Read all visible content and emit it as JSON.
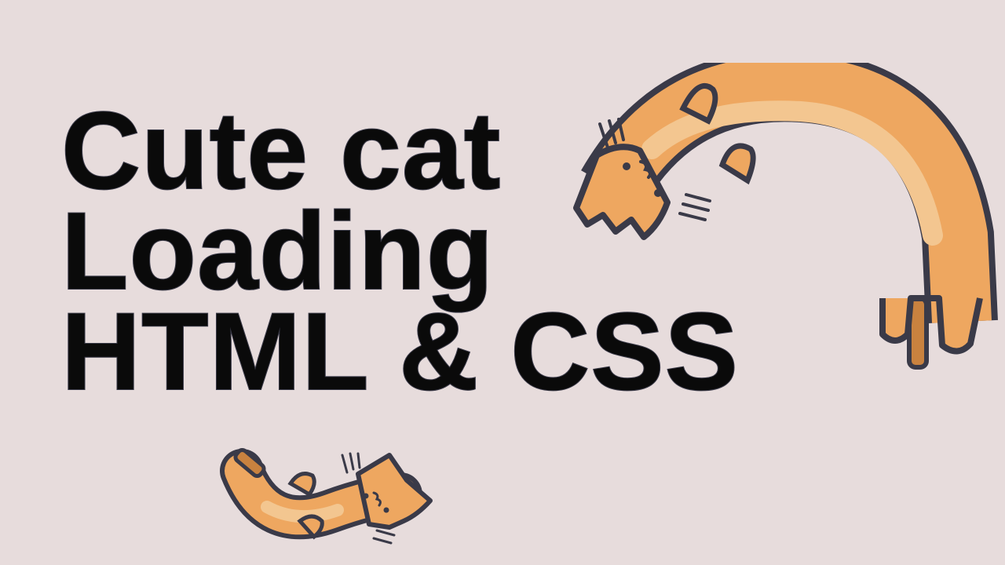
{
  "page": {
    "background": "#e7dcdc"
  },
  "title": {
    "lines": [
      "Cute cat",
      "Loading",
      "HTML & CSS"
    ],
    "color": "#0a0a0a",
    "outline": "#3a3a48"
  },
  "cats": {
    "fur": "#eea760",
    "fur_light": "#f3c690",
    "tail": "#c9823f",
    "outline": "#3a3a48"
  }
}
